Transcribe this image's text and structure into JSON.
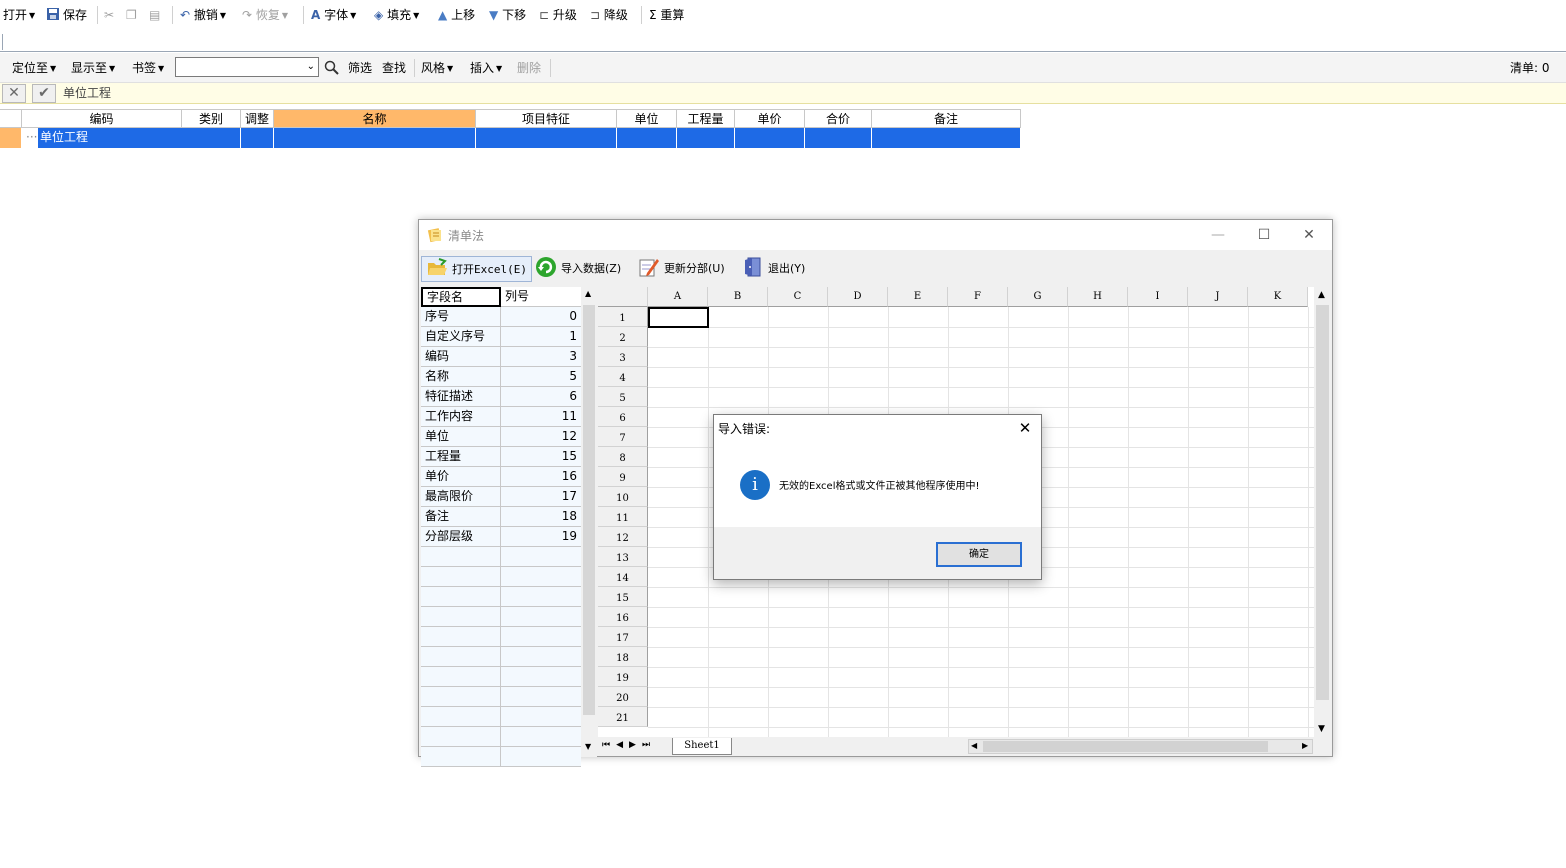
{
  "toolbar": {
    "open": "打开",
    "save": "保存",
    "undo": "撤销",
    "redo": "恢复",
    "font": "字体",
    "fill": "填充",
    "move_up": "上移",
    "move_down": "下移",
    "upgrade": "升级",
    "downgrade": "降级",
    "recalc": "重算",
    "sigma": "Σ"
  },
  "toolbar2": {
    "locate": "定位至",
    "display": "显示至",
    "bookmark": "书签",
    "filter": "筛选",
    "find": "查找",
    "style": "风格",
    "insert": "插入",
    "delete": "删除",
    "list_count": "清单: 0"
  },
  "editbar": {
    "value": "单位工程"
  },
  "grid": {
    "headers": [
      "编码",
      "类别",
      "调整",
      "名称",
      "项目特征",
      "单位",
      "工程量",
      "单价",
      "合价",
      "备注"
    ],
    "row": {
      "code": "单位工程"
    }
  },
  "window": {
    "title": "清单法",
    "buttons": {
      "open_excel": "打开Excel(E)",
      "import": "导入数据(Z)",
      "update": "更新分部(U)",
      "exit": "退出(Y)"
    },
    "field_table": {
      "headers": [
        "字段名",
        "列号"
      ],
      "rows": [
        {
          "name": "序号",
          "col": "0"
        },
        {
          "name": "自定义序号",
          "col": "1"
        },
        {
          "name": "编码",
          "col": "3"
        },
        {
          "name": "名称",
          "col": "5"
        },
        {
          "name": "特征描述",
          "col": "6"
        },
        {
          "name": "工作内容",
          "col": "11"
        },
        {
          "name": "单位",
          "col": "12"
        },
        {
          "name": "工程量",
          "col": "15"
        },
        {
          "name": "单价",
          "col": "16"
        },
        {
          "name": "最高限价",
          "col": "17"
        },
        {
          "name": "备注",
          "col": "18"
        },
        {
          "name": "分部层级",
          "col": "19"
        }
      ]
    },
    "sheet": {
      "columns": [
        "A",
        "B",
        "C",
        "D",
        "E",
        "F",
        "G",
        "H",
        "I",
        "J",
        "K"
      ],
      "rows": [
        "1",
        "2",
        "3",
        "4",
        "5",
        "6",
        "7",
        "8",
        "9",
        "10",
        "11",
        "12",
        "13",
        "14",
        "15",
        "16",
        "17",
        "18",
        "19",
        "20",
        "21"
      ],
      "tab": "Sheet1"
    }
  },
  "message": {
    "title": "导入错误:",
    "text": "无效的Excel格式或文件正被其他程序使用中!",
    "ok": "确定",
    "icon": "i"
  }
}
